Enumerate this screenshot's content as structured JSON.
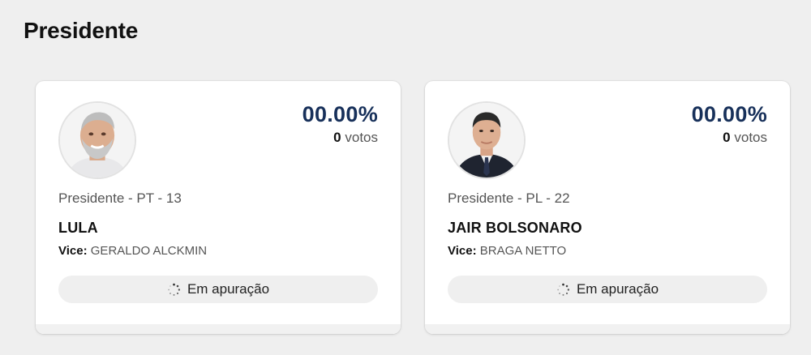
{
  "section": {
    "title": "Presidente"
  },
  "candidates": [
    {
      "percent": "00.00%",
      "votes_count": "0",
      "votes_unit": "votos",
      "role_line": "Presidente - PT - 13",
      "name": "LULA",
      "vice_label": "Vice:",
      "vice_name": "GERALDO ALCKMIN",
      "status": "Em apuração",
      "photo": "candidate-photo"
    },
    {
      "percent": "00.00%",
      "votes_count": "0",
      "votes_unit": "votos",
      "role_line": "Presidente - PL - 22",
      "name": "JAIR BOLSONARO",
      "vice_label": "Vice:",
      "vice_name": "BRAGA NETTO",
      "status": "Em apuração",
      "photo": "candidate-photo"
    }
  ],
  "icons": {
    "status": "loading-spinner-icon"
  }
}
